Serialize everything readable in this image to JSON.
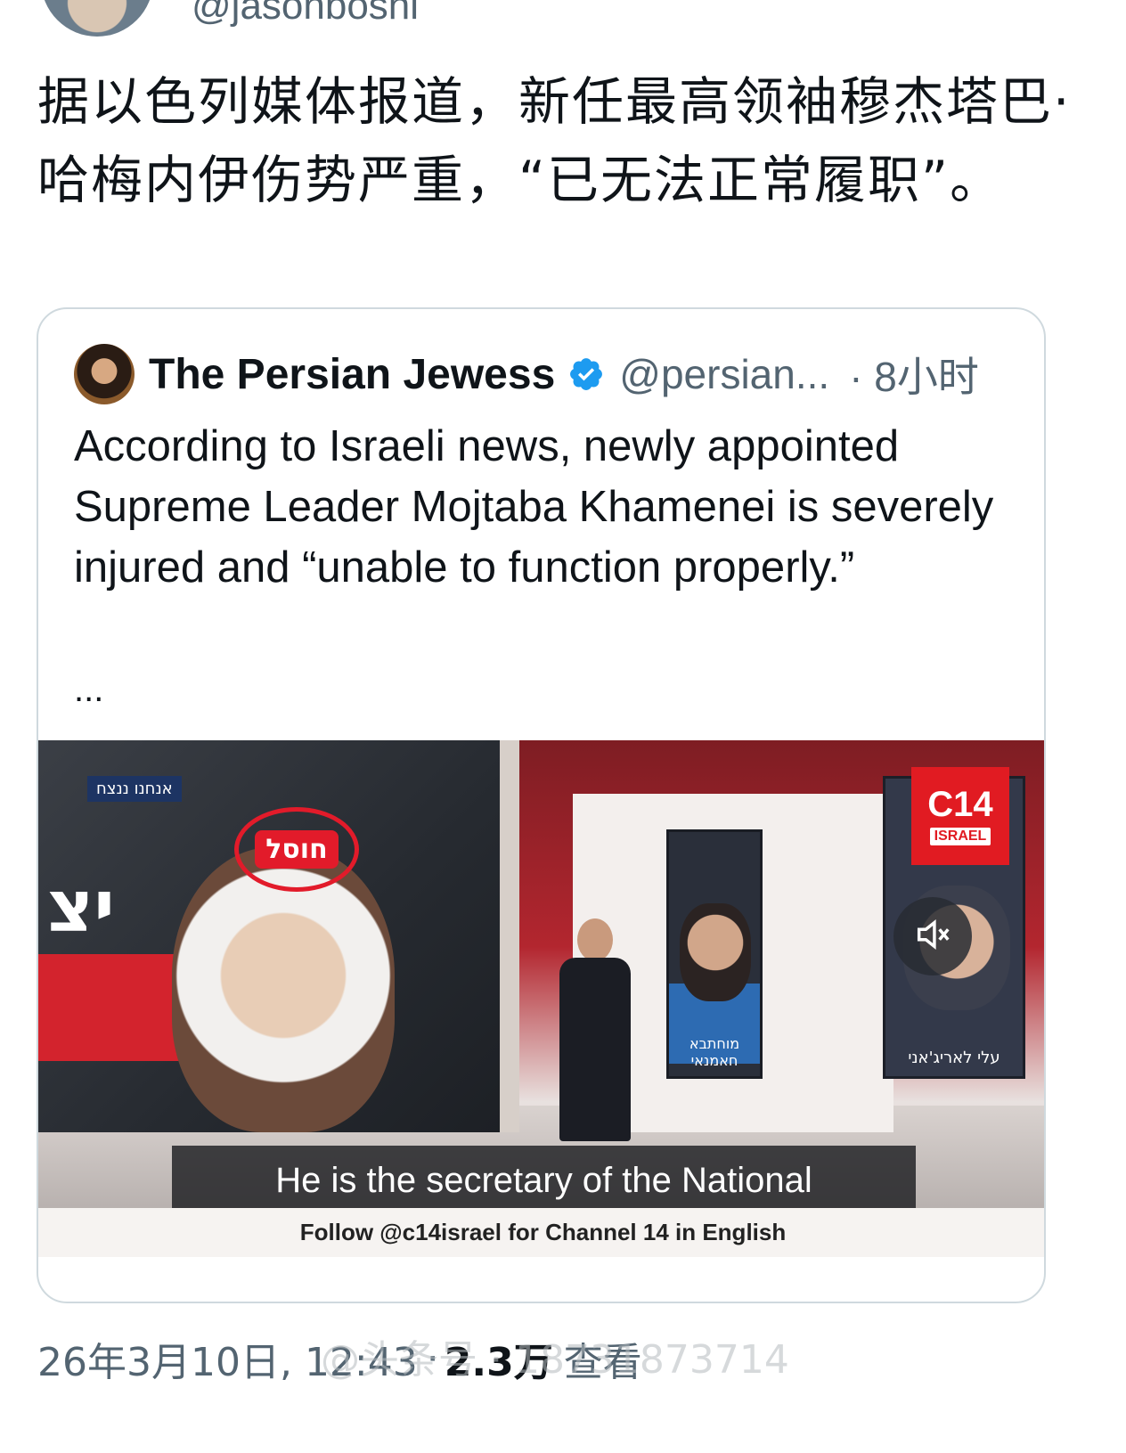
{
  "top": {
    "handle": "@jasonboshi"
  },
  "tweet": {
    "text": "据以色列媒体报道，新任最高领袖穆杰塔巴·哈梅内伊伤势严重，“已无法正常履职”。",
    "date": "26年3月10日, 12:43",
    "separator": "·",
    "views_count": "2.3万",
    "views_label": "查看"
  },
  "quote": {
    "name": "The Persian Jewess",
    "handle": "@persian...",
    "time": "· 8小时",
    "body": "According to Israeli news, newly appointed Supreme Leader Mojtaba Khamenei is severely injured and “unable to function properly.”",
    "more": "..."
  },
  "video": {
    "subtitle": "He is the secretary of the National",
    "footer_text": "Follow @c14israel for Channel 14 in English",
    "logo_main": "C14",
    "logo_sub": "ISRAEL",
    "stamp_text": "חוסל",
    "left_tag": "אנחנו ננצח",
    "big_hebrew": "יצ",
    "poster1_caption": "מוחתבא חאמנאי",
    "poster2_caption": "עלי לאריג'אני"
  },
  "watermark": {
    "text": "@头条号 · 18731873714"
  },
  "colors": {
    "verified_blue": "#1d9bf0",
    "text_primary": "#0f1419",
    "text_secondary": "#536471",
    "border": "#cfd9de",
    "c14_red": "#e11b22"
  },
  "icons": {
    "verified": "verified-badge-icon",
    "mute": "muted-speaker-icon"
  }
}
